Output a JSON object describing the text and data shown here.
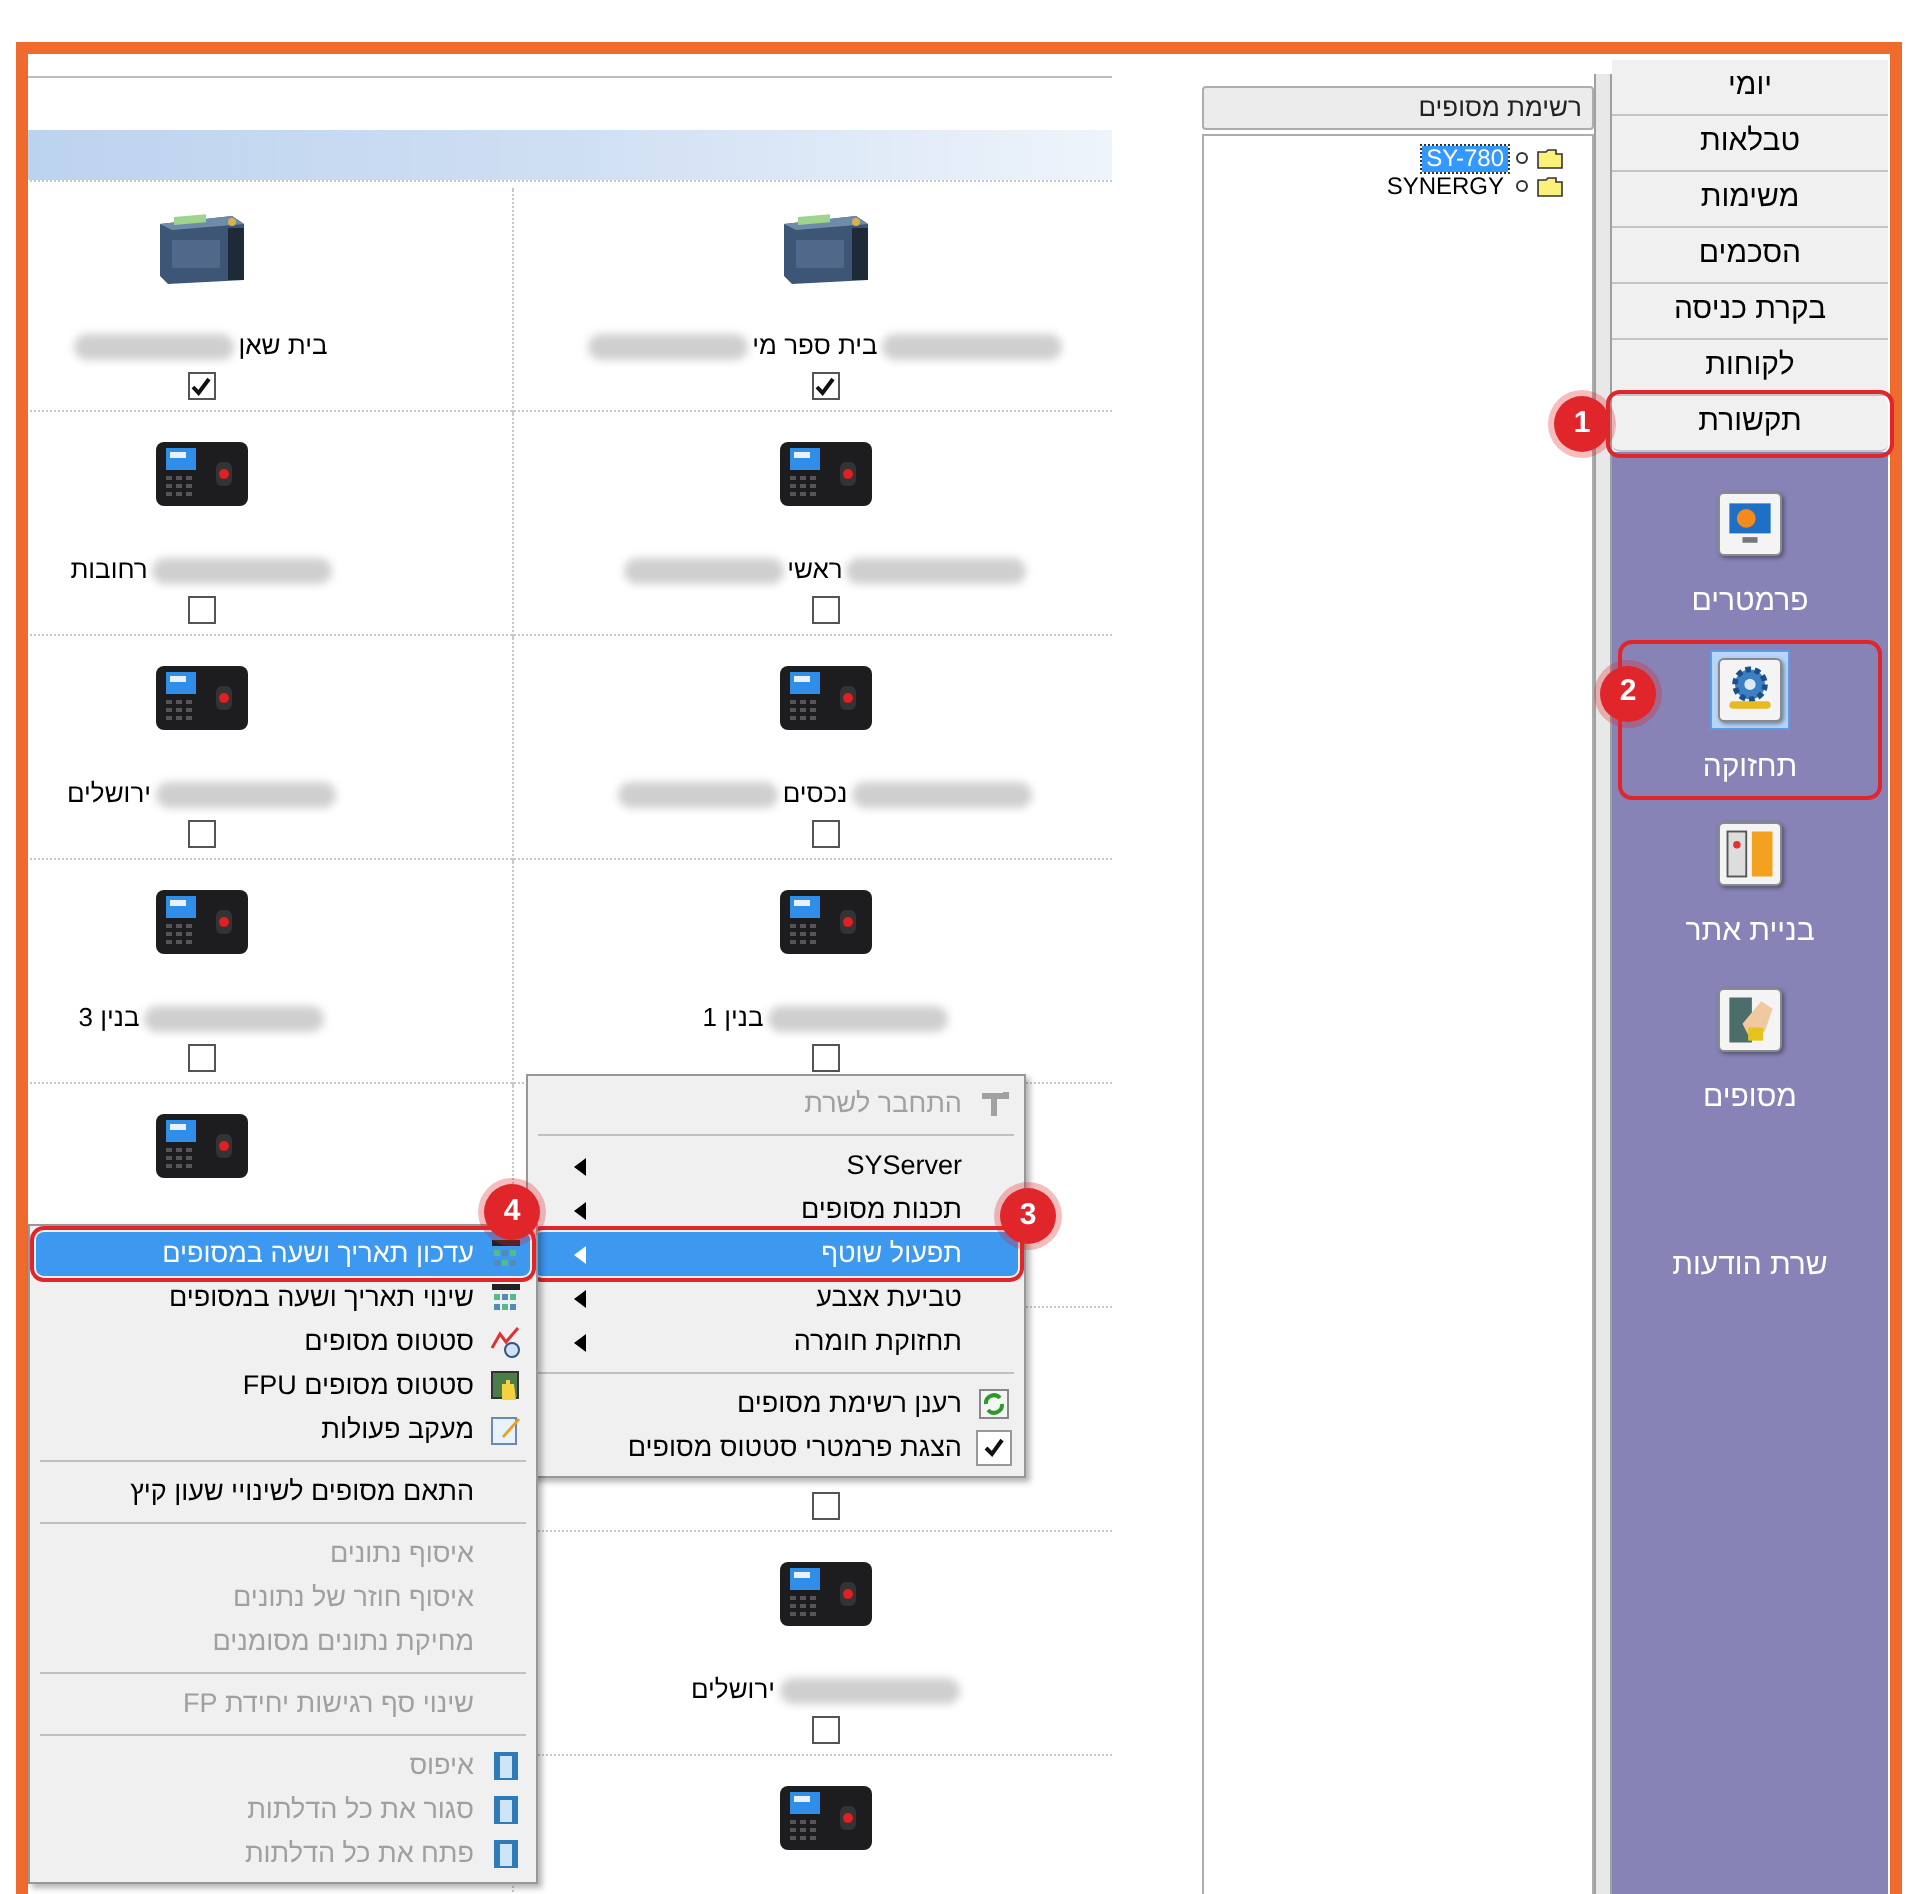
{
  "terminals": [
    {
      "kind": "classic",
      "label": "בית ספר מי",
      "blur_left": true,
      "blur_right": true,
      "checked": true
    },
    {
      "kind": "classic",
      "label": "בית שאן",
      "blur_left": true,
      "blur_right": false,
      "checked": true
    },
    {
      "kind": "fingerprint",
      "label": "ראשי",
      "blur_left": true,
      "blur_right": true,
      "checked": false
    },
    {
      "kind": "fingerprint",
      "label": "רחובות",
      "blur_left": false,
      "blur_right": true,
      "checked": false
    },
    {
      "kind": "fingerprint",
      "label": "נכסים",
      "blur_left": true,
      "blur_right": true,
      "checked": false
    },
    {
      "kind": "fingerprint",
      "label": "ירושלים",
      "blur_left": false,
      "blur_right": true,
      "checked": false
    },
    {
      "kind": "fingerprint",
      "label": "בנין 1",
      "blur_left": false,
      "blur_right": true,
      "checked": false
    },
    {
      "kind": "fingerprint",
      "label": "בנין 3",
      "blur_left": false,
      "blur_right": true,
      "checked": false
    },
    {
      "kind": "blank"
    },
    {
      "kind": "fingerprint"
    },
    {
      "kind": "blank",
      "checked": false
    },
    {
      "kind": "blank"
    },
    {
      "kind": "fingerprint",
      "label": "ירושלים",
      "blur_left": false,
      "blur_right": true,
      "checked": false
    },
    {
      "kind": "blank"
    },
    {
      "kind": "fingerprint"
    },
    {
      "kind": "blank"
    }
  ],
  "terminal_list": {
    "title": "רשימת מסופים",
    "items": [
      {
        "label": "SY-780",
        "selected": true
      },
      {
        "label": "SYNERGY",
        "selected": false
      }
    ]
  },
  "sidebar": {
    "tabs": [
      {
        "label": "יומי"
      },
      {
        "label": "טבלאות"
      },
      {
        "label": "משימות"
      },
      {
        "label": "הסכמים"
      },
      {
        "label": "בקרת כניסה"
      },
      {
        "label": "לקוחות"
      },
      {
        "label": "תקשורת",
        "annotation": "1"
      }
    ],
    "items": [
      {
        "label": "פרמטרים",
        "selected": false
      },
      {
        "label": "תחזוקה",
        "selected": true,
        "annotation": "2"
      },
      {
        "label": "בניית אתר",
        "selected": false
      },
      {
        "label": "מסופים",
        "selected": false
      }
    ],
    "footer": "שרת הודעות"
  },
  "context_menu": [
    {
      "kind": "item",
      "label": "התחבר לשרת",
      "disabled": true,
      "submenu": false,
      "selected": false
    },
    {
      "kind": "separator"
    },
    {
      "kind": "item",
      "label": "SYServer",
      "disabled": false,
      "submenu": true,
      "selected": false
    },
    {
      "kind": "item",
      "label": "תכנות מסופים",
      "disabled": false,
      "submenu": true,
      "selected": false
    },
    {
      "kind": "item",
      "label": "תפעול שוטף",
      "disabled": false,
      "submenu": true,
      "selected": true,
      "annotation": "3"
    },
    {
      "kind": "item",
      "label": "טביעת אצבע",
      "disabled": false,
      "submenu": true,
      "selected": false
    },
    {
      "kind": "item",
      "label": "תחזוקת חומרה",
      "disabled": false,
      "submenu": true,
      "selected": false
    },
    {
      "kind": "separator"
    },
    {
      "kind": "item",
      "label": "רענן רשימת מסופים",
      "disabled": false,
      "submenu": false,
      "selected": false
    },
    {
      "kind": "item",
      "label": "הצגת פרמטרי סטטוס מסופים",
      "disabled": false,
      "submenu": false,
      "selected": false,
      "checked": true
    }
  ],
  "submenu": [
    {
      "kind": "item",
      "label": "עדכון תאריך ושעה במסופים",
      "disabled": false,
      "selected": true,
      "annotation": "4"
    },
    {
      "kind": "item",
      "label": "שינוי תאריך ושעה במסופים",
      "disabled": false,
      "selected": false
    },
    {
      "kind": "item",
      "label": "סטטוס מסופים",
      "disabled": false,
      "selected": false
    },
    {
      "kind": "item",
      "label": "סטטוס מסופים FPU",
      "disabled": false,
      "selected": false
    },
    {
      "kind": "item",
      "label": "מעקב פעולות",
      "disabled": false,
      "selected": false
    },
    {
      "kind": "separator"
    },
    {
      "kind": "item",
      "label": "התאם מסופים לשינויי שעון קיץ",
      "disabled": false,
      "selected": false
    },
    {
      "kind": "separator"
    },
    {
      "kind": "item",
      "label": "איסוף נתונים",
      "disabled": true,
      "selected": false
    },
    {
      "kind": "item",
      "label": "איסוף חוזר של נתונים",
      "disabled": true,
      "selected": false
    },
    {
      "kind": "item",
      "label": "מחיקת נתונים מסומנים",
      "disabled": true,
      "selected": false
    },
    {
      "kind": "separator"
    },
    {
      "kind": "item",
      "label": "שינוי סף רגישות יחידת FP",
      "disabled": true,
      "selected": false
    },
    {
      "kind": "separator"
    },
    {
      "kind": "item",
      "label": "איפוס",
      "disabled": true,
      "selected": false
    },
    {
      "kind": "item",
      "label": "סגור את כל הדלתות",
      "disabled": true,
      "selected": false
    },
    {
      "kind": "item",
      "label": "פתח את כל הדלתות",
      "disabled": true,
      "selected": false
    }
  ]
}
